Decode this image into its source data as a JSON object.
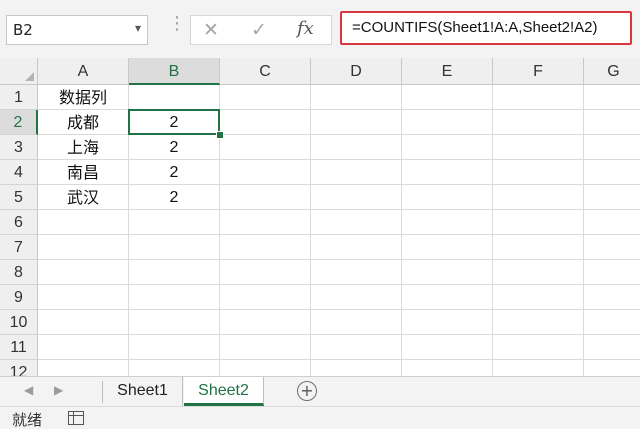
{
  "formula_bar": {
    "name_box": "B2",
    "name_box_dropdown_icon": "chevron-down-icon",
    "separator_icon": "vertical-dots-icon",
    "cancel_icon": "✕",
    "enter_icon": "✓",
    "fx_label": "fx",
    "formula": "=COUNTIFS(Sheet1!A:A,Sheet2!A2)"
  },
  "columns": [
    "A",
    "B",
    "C",
    "D",
    "E",
    "F",
    "G"
  ],
  "active_column": "B",
  "rows": [
    "1",
    "2",
    "3",
    "4",
    "5",
    "6",
    "7",
    "8",
    "9",
    "10",
    "11",
    "12"
  ],
  "active_row": "2",
  "cells": {
    "A1": "数据列",
    "A2": "成都",
    "A3": "上海",
    "A4": "南昌",
    "A5": "武汉",
    "B2": "2",
    "B3": "2",
    "B4": "2",
    "B5": "2"
  },
  "selected_cell": "B2",
  "sheet_tabs": {
    "items": [
      "Sheet1",
      "Sheet2"
    ],
    "active": "Sheet2",
    "add_label": "+"
  },
  "status_bar": {
    "ready_text": "就绪",
    "macro_icon": "macro-record-icon"
  },
  "colors": {
    "accent": "#217346",
    "formula_highlight": "#d9363e"
  }
}
